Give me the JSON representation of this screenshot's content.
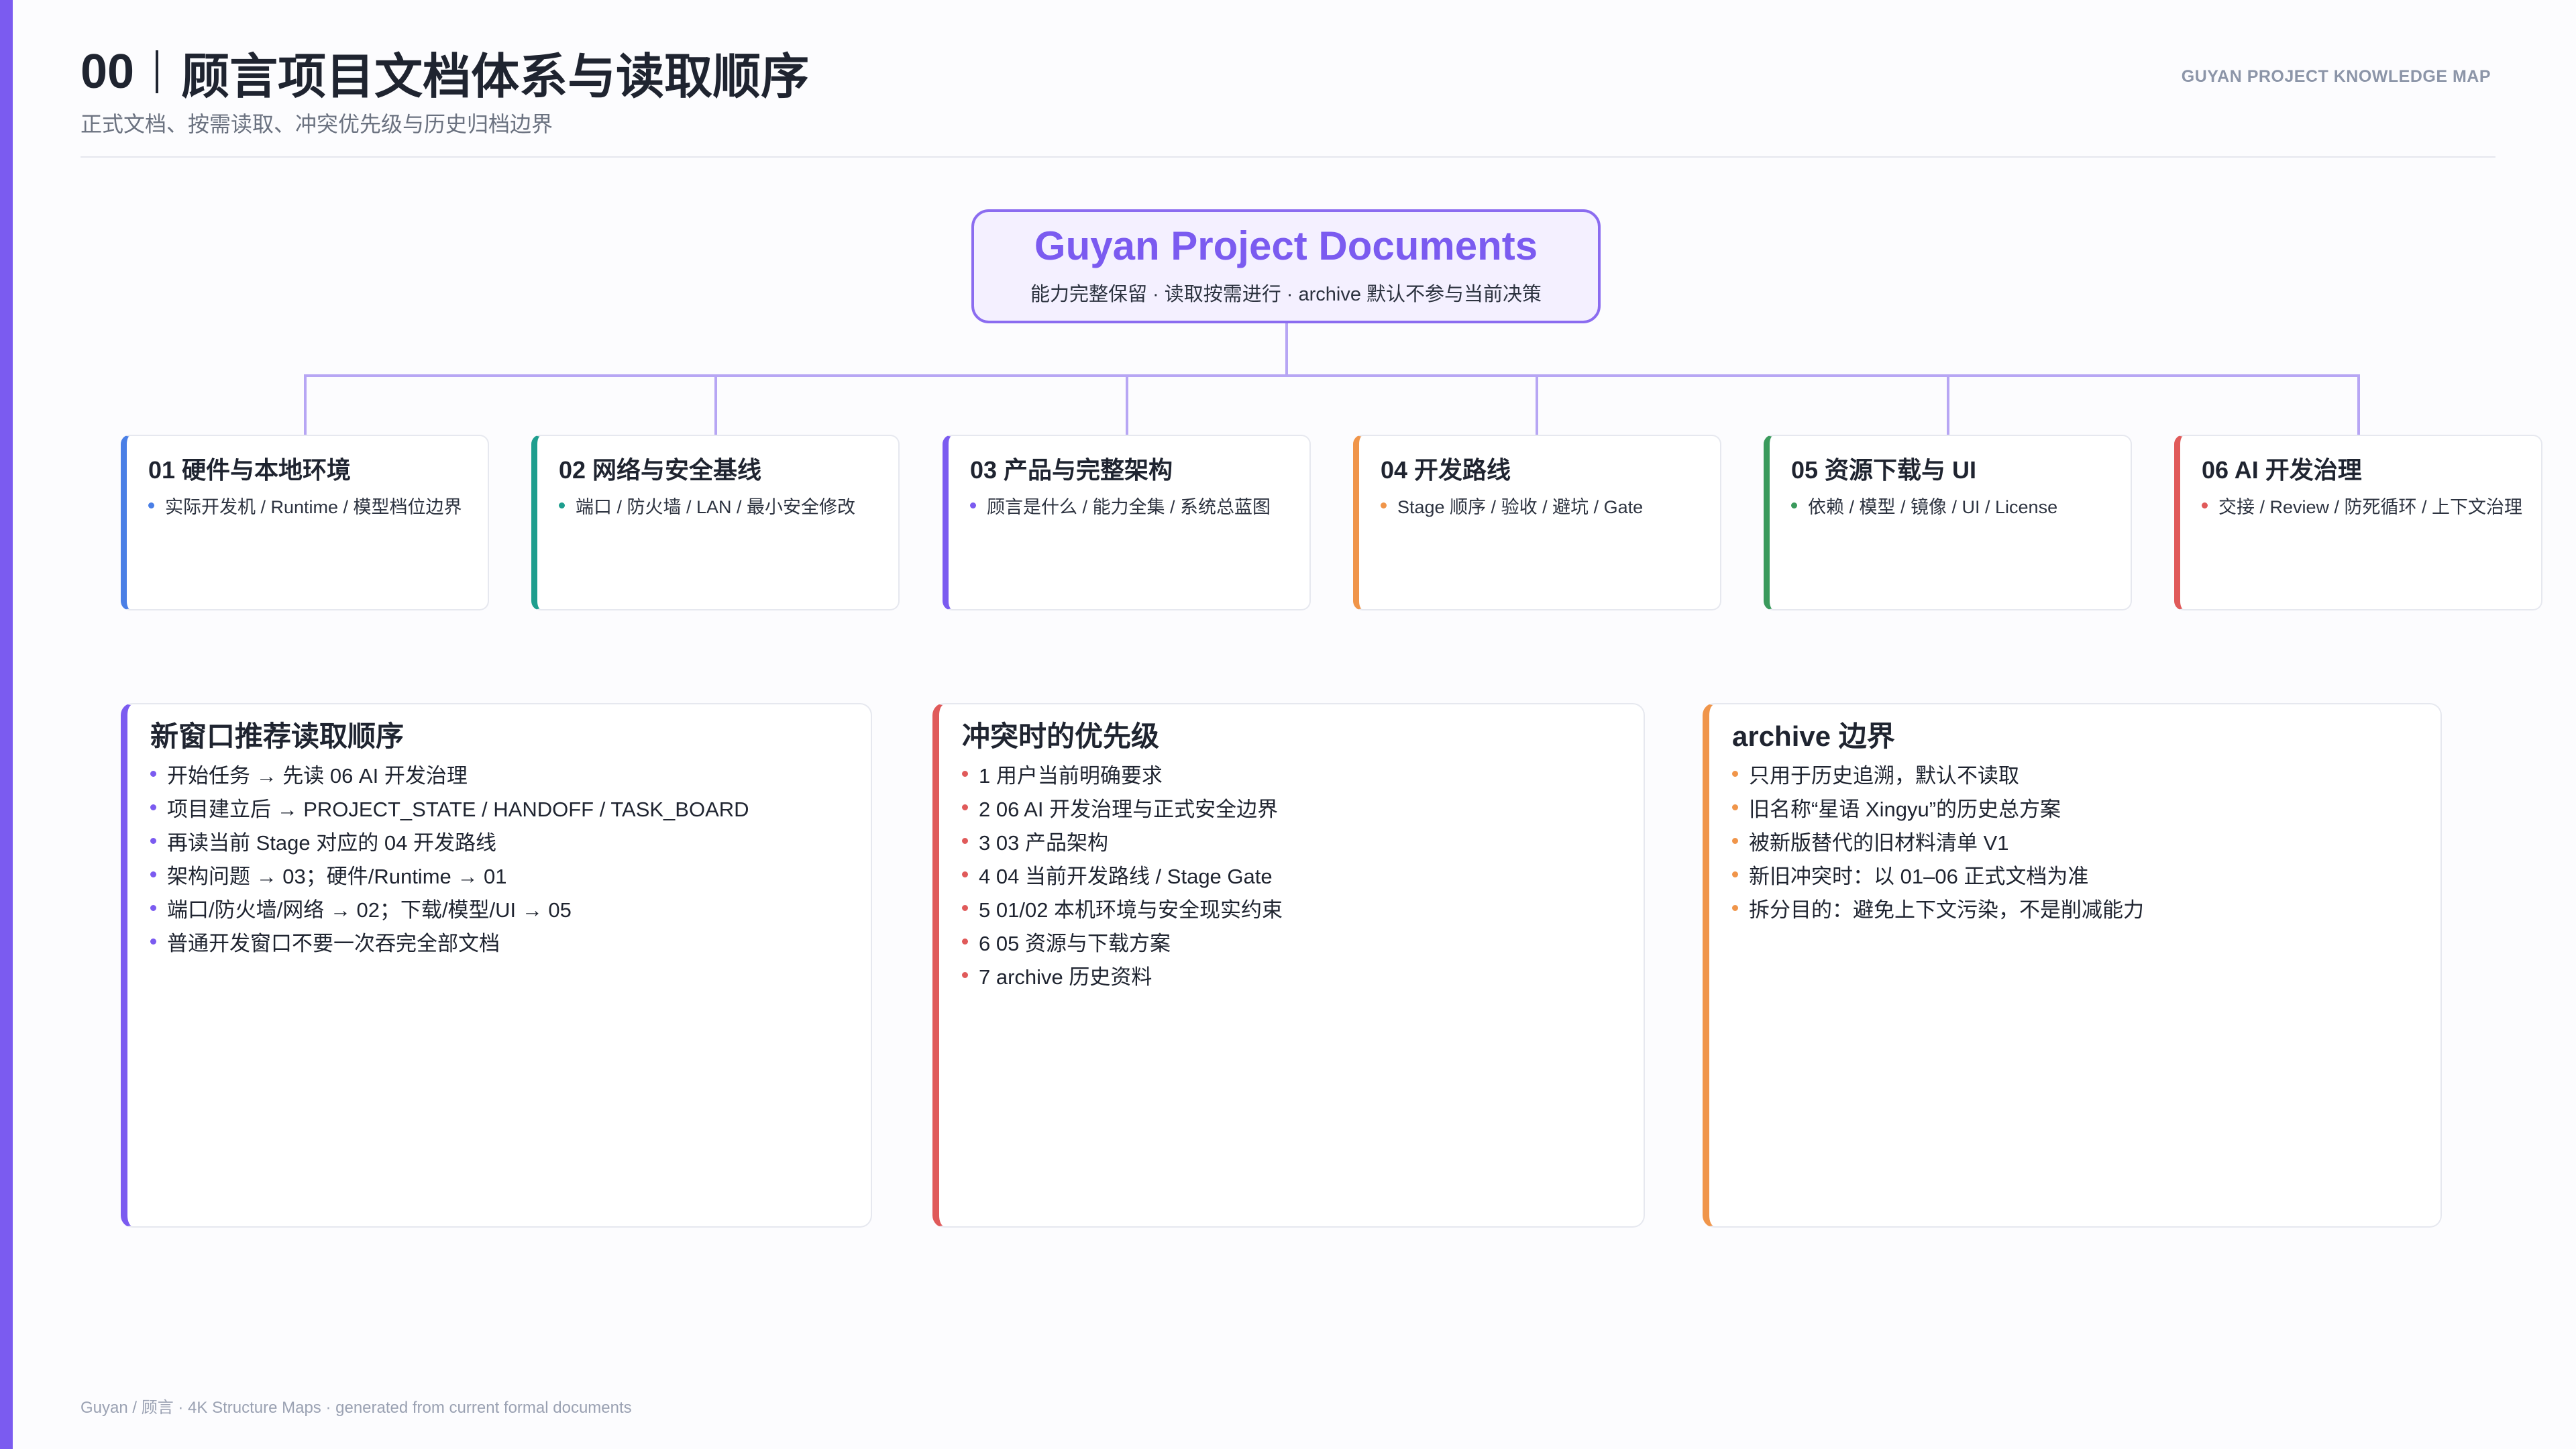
{
  "header": {
    "number": "00",
    "title": "顾言项目文档体系与读取顺序",
    "subtitle": "正式文档、按需读取、冲突优先级与历史归档边界",
    "tag": "GUYAN PROJECT KNOWLEDGE MAP"
  },
  "root": {
    "title": "Guyan Project Documents",
    "subtitle": "能力完整保留 · 读取按需进行 · archive 默认不参与当前决策"
  },
  "categories": [
    {
      "title": "01 硬件与本地环境",
      "desc": "实际开发机 / Runtime / 模型档位边界",
      "color": "#4a7fe6"
    },
    {
      "title": "02 网络与安全基线",
      "desc": "端口 / 防火墙 / LAN / 最小安全修改",
      "color": "#1e9e8e"
    },
    {
      "title": "03 产品与完整架构",
      "desc": "顾言是什么 / 能力全集 / 系统总蓝图",
      "color": "#7b5bf0"
    },
    {
      "title": "04 开发路线",
      "desc": "Stage 顺序 / 验收 / 避坑 / Gate",
      "color": "#f0954a"
    },
    {
      "title": "05 资源下载与 UI",
      "desc": "依赖 / 模型 / 镜像 / UI / License",
      "color": "#3a9a5c"
    },
    {
      "title": "06 AI 开发治理",
      "desc": "交接 / Review / 防死循环 / 上下文治理",
      "color": "#e05a5a"
    }
  ],
  "panels": [
    {
      "title": "新窗口推荐读取顺序",
      "color": "#7b5bf0",
      "items": [
        "开始任务 → 先读 06 AI 开发治理",
        "项目建立后 → PROJECT_STATE / HANDOFF / TASK_BOARD",
        "再读当前 Stage 对应的 04 开发路线",
        "架构问题 → 03；硬件/Runtime → 01",
        "端口/防火墙/网络 → 02；下载/模型/UI → 05",
        "普通开发窗口不要一次吞完全部文档"
      ]
    },
    {
      "title": "冲突时的优先级",
      "color": "#e05a5a",
      "items": [
        "1 用户当前明确要求",
        "2 06 AI 开发治理与正式安全边界",
        "3 03 产品架构",
        "4 04 当前开发路线 / Stage Gate",
        "5 01/02 本机环境与安全现实约束",
        "6 05 资源与下载方案",
        "7 archive 历史资料"
      ]
    },
    {
      "title": "archive 边界",
      "color": "#f0954a",
      "items": [
        "只用于历史追溯，默认不读取",
        "旧名称“星语 Xingyu”的历史总方案",
        "被新版替代的旧材料清单 V1",
        "新旧冲突时：以 01–06 正式文档为准",
        "拆分目的：避免上下文污染，不是削减能力"
      ]
    }
  ],
  "footer": "Guyan / 顾言 · 4K Structure Maps · generated from current formal documents"
}
